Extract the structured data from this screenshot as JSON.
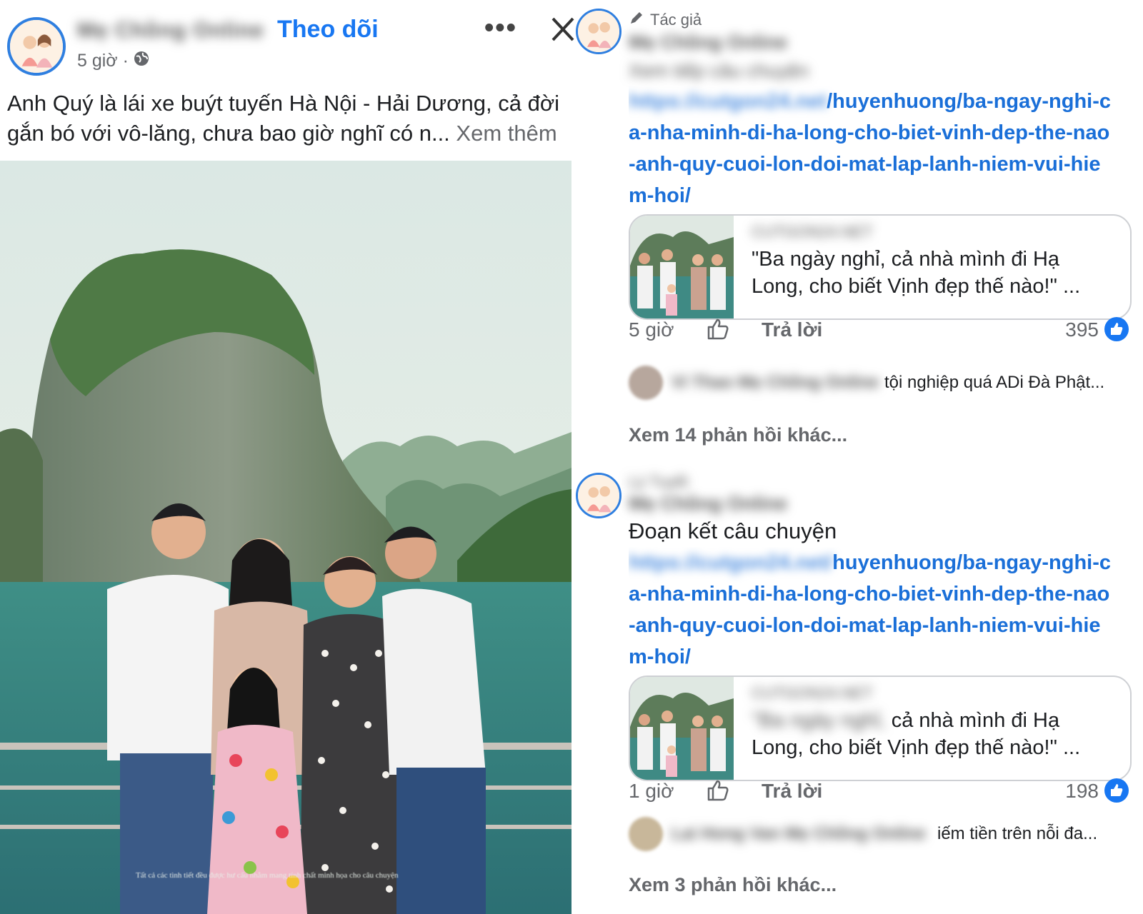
{
  "post": {
    "author_name": "Mẹ Chồng Online",
    "follow_label": "Theo dõi",
    "more_label": "•••",
    "time": "5 giờ ·",
    "text": "Anh Quý là lái xe buýt tuyến Hà Nội - Hải Dương, cả đời gắn bó với vô-lăng, chưa bao giờ nghĩ có n...",
    "see_more": "Xem thêm",
    "photo_caption": "Tất cả các tình tiết đều được hư cấu nhằm mang tính chất minh họa cho câu chuyện"
  },
  "comments": [
    {
      "badge": "Tác giả",
      "name": "Mẹ Chồng Online",
      "subtitle": "Xem tiếp câu chuyện",
      "link_hidden": "https://cutgon24.net",
      "link_visible": "/huyenhuong/ba-ngay-nghi-ca-nha-minh-di-ha-long-cho-biet-vinh-dep-the-nao-anh-quy-cuoi-lon-doi-mat-lap-lanh-niem-vui-hiem-hoi/",
      "card_site": "CUTGON24.NET",
      "card_quote": "\"Ba ngày nghỉ, cả nhà mình đi Hạ Long, cho biết Vịnh đẹp thế nào!\" ...",
      "time": "5 giờ",
      "reply_label": "Trả lời",
      "reaction_count": "395",
      "reply_preview_name": "Vi Thao Mẹ Chồng Online",
      "reply_preview_text": "tội nghiệp quá ADi Đà Phật...",
      "view_more": "Xem 14 phản hồi khác..."
    },
    {
      "badge": "Lý Tuyết",
      "name": "Mẹ Chồng Online",
      "text": "Đoạn kết câu chuyện",
      "link_hidden": "https://cutgon24.net/",
      "link_visible": "huyenhuong/ba-ngay-nghi-ca-nha-minh-di-ha-long-cho-biet-vinh-dep-the-nao-anh-quy-cuoi-lon-doi-mat-lap-lanh-niem-vui-hiem-hoi/",
      "card_site": "CUTGON24.NET",
      "card_quote_hidden": "\"Ba ngày nghỉ,",
      "card_quote": "cả nhà mình đi Hạ Long, cho biết Vịnh đẹp thế nào!\" ...",
      "time": "1 giờ",
      "reply_label": "Trả lời",
      "reaction_count": "198",
      "reply_preview_name": "Lai Hong Van Mẹ Chồng Online",
      "reply_preview_text": "iếm tiền trên nỗi đa...",
      "view_more": "Xem 3 phản hồi khác..."
    }
  ],
  "colors": {
    "accent": "#1877f2",
    "link": "#1a6fd8",
    "muted": "#65676b",
    "avatar_ring": "#2f7fe0"
  },
  "icons": [
    "globe-icon",
    "close-icon",
    "more-icon",
    "pencil-icon",
    "like-icon",
    "like-reaction-icon"
  ]
}
